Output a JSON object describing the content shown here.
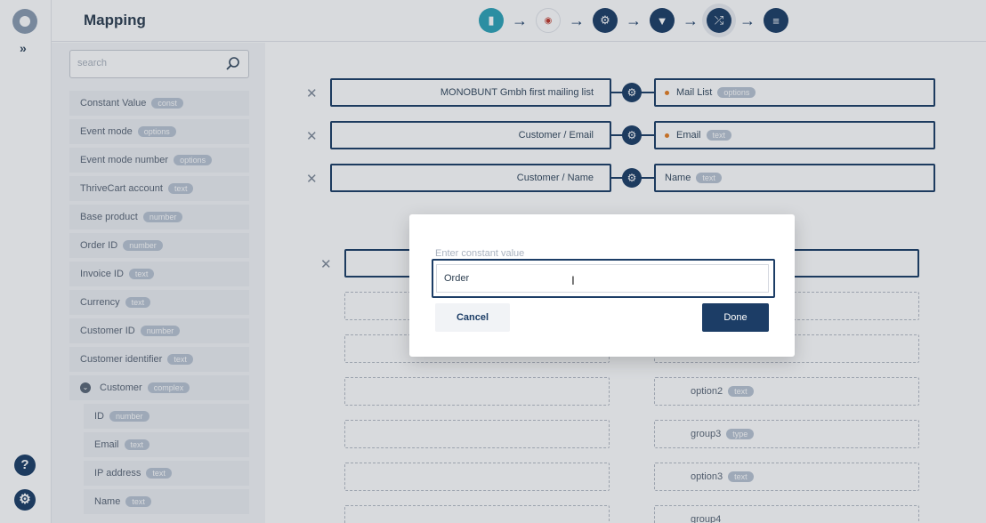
{
  "app": {
    "title": "Mapping",
    "expand_label": "»"
  },
  "rail": {
    "help_label": "?",
    "settings_label": "⚙"
  },
  "steps": [
    {
      "icon": "chart-icon",
      "glyph": "▮"
    },
    {
      "icon": "thrivecart-logo-icon",
      "glyph": "◉"
    },
    {
      "icon": "gear-icon",
      "glyph": "⚙"
    },
    {
      "icon": "filter-icon",
      "glyph": "▼"
    },
    {
      "icon": "shuffle-icon",
      "glyph": "⤮"
    },
    {
      "icon": "list-icon",
      "glyph": "≡"
    }
  ],
  "search": {
    "placeholder": "search"
  },
  "fields": [
    {
      "label": "Constant Value",
      "badge": "const"
    },
    {
      "label": "Event mode",
      "badge": "options"
    },
    {
      "label": "Event mode number",
      "badge": "options"
    },
    {
      "label": "ThriveCart account",
      "badge": "text"
    },
    {
      "label": "Base product",
      "badge": "number"
    },
    {
      "label": "Order ID",
      "badge": "number"
    },
    {
      "label": "Invoice ID",
      "badge": "text"
    },
    {
      "label": "Currency",
      "badge": "text"
    },
    {
      "label": "Customer ID",
      "badge": "number"
    },
    {
      "label": "Customer identifier",
      "badge": "text"
    },
    {
      "label": "Customer",
      "badge": "complex"
    },
    {
      "label": "ID",
      "badge": "number"
    },
    {
      "label": "Email",
      "badge": "text"
    },
    {
      "label": "IP address",
      "badge": "text"
    },
    {
      "label": "Name",
      "badge": "text"
    }
  ],
  "mappings": [
    {
      "source": "MONOBUNT Gmbh first mailing list",
      "target": "Mail List",
      "badge": "options"
    },
    {
      "source": "Customer / Email",
      "target": "Email",
      "badge": "text"
    },
    {
      "source": "Customer / Name",
      "target": "Name",
      "badge": "text"
    }
  ],
  "targets_more": [
    {
      "label": "option2",
      "badge": "text"
    },
    {
      "label": "group3",
      "badge": "type"
    },
    {
      "label": "option3",
      "badge": "text"
    },
    {
      "label": "group4",
      "badge": ""
    }
  ],
  "modal": {
    "label": "Enter constant value",
    "value": "Order",
    "cancel": "Cancel",
    "done": "Done"
  },
  "colors": {
    "primary": "#1c3d66",
    "accent": "#2ea3b7",
    "required_dot": "#e67e22"
  }
}
